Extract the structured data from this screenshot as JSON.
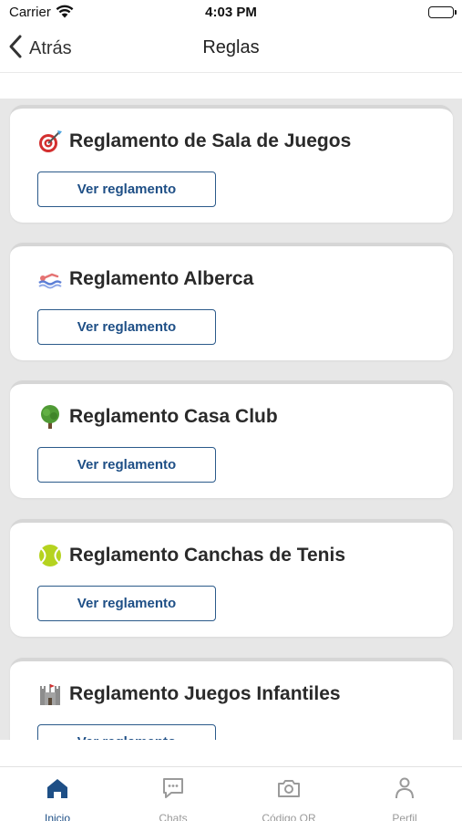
{
  "status_bar": {
    "carrier": "Carrier",
    "time": "4:03 PM"
  },
  "nav": {
    "back_label": "Atrás",
    "title": "Reglas"
  },
  "cards": [
    {
      "title": "Reglamento de Sala de Juegos",
      "button_label": "Ver reglamento",
      "icon": "target-dart-icon"
    },
    {
      "title": "Reglamento Alberca",
      "button_label": "Ver reglamento",
      "icon": "swimmer-icon"
    },
    {
      "title": "Reglamento Casa Club",
      "button_label": "Ver reglamento",
      "icon": "tree-icon"
    },
    {
      "title": "Reglamento Canchas de Tenis",
      "button_label": "Ver reglamento",
      "icon": "tennis-ball-icon"
    },
    {
      "title": "Reglamento Juegos Infantiles",
      "button_label": "Ver reglamento",
      "icon": "castle-icon"
    }
  ],
  "tabs": [
    {
      "label": "Inicio",
      "icon": "home-icon",
      "active": true
    },
    {
      "label": "Chats",
      "icon": "chat-icon",
      "active": false
    },
    {
      "label": "Código QR",
      "icon": "camera-icon",
      "active": false
    },
    {
      "label": "Perfil",
      "icon": "person-icon",
      "active": false
    }
  ],
  "colors": {
    "accent": "#1e4f86",
    "inactive": "#9a9a9a",
    "background": "#e7e7e7"
  }
}
